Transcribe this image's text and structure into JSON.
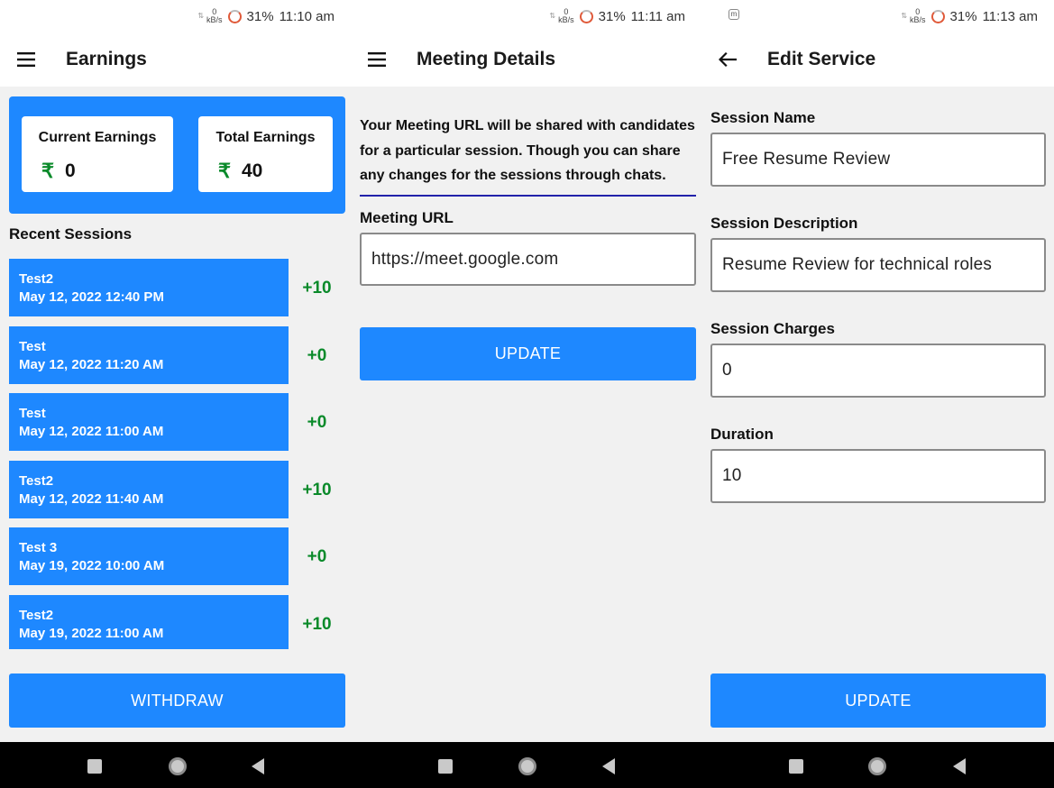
{
  "status_bars": [
    {
      "rate_value": "0",
      "rate_unit": "kB/s",
      "battery": "31%",
      "time": "11:10 am"
    },
    {
      "rate_value": "0",
      "rate_unit": "kB/s",
      "battery": "31%",
      "time": "11:11 am"
    },
    {
      "rate_value": "0",
      "rate_unit": "kB/s",
      "battery": "31%",
      "time": "11:13 am",
      "left_icon": "m"
    }
  ],
  "earnings_screen": {
    "title": "Earnings",
    "current_label": "Current Earnings",
    "current_value": "0",
    "total_label": "Total Earnings",
    "total_value": "40",
    "currency_symbol": "₹",
    "recent_title": "Recent Sessions",
    "sessions": [
      {
        "name": "Test2",
        "datetime": "May 12, 2022 12:40 PM",
        "amount": "+10"
      },
      {
        "name": "Test",
        "datetime": "May 12, 2022 11:20 AM",
        "amount": "+0"
      },
      {
        "name": "Test",
        "datetime": "May 12, 2022 11:00 AM",
        "amount": "+0"
      },
      {
        "name": "Test2",
        "datetime": "May 12, 2022 11:40 AM",
        "amount": "+10"
      },
      {
        "name": "Test 3",
        "datetime": "May 19, 2022 10:00 AM",
        "amount": "+0"
      },
      {
        "name": "Test2",
        "datetime": "May 19, 2022 11:00 AM",
        "amount": "+10"
      }
    ],
    "withdraw_label": "WITHDRAW"
  },
  "meeting_screen": {
    "title": "Meeting Details",
    "info_text": "Your Meeting URL will be shared with candidates for a particular session. Though you can share any changes for the sessions through chats.",
    "url_label": "Meeting URL",
    "url_value": "https://meet.google.com",
    "update_label": "UPDATE"
  },
  "edit_screen": {
    "title": "Edit Service",
    "name_label": "Session Name",
    "name_value": "Free Resume Review",
    "desc_label": "Session Description",
    "desc_value": "Resume Review for technical roles",
    "charges_label": "Session Charges",
    "charges_value": "0",
    "duration_label": "Duration",
    "duration_value": "10",
    "update_label": "UPDATE"
  },
  "colors": {
    "accent": "#1e88ff",
    "positive": "#0a8a2a",
    "background": "#f1f1f1"
  },
  "icons": {
    "menu": "hamburger-menu-icon",
    "back": "back-arrow-icon",
    "currency": "rupee-icon"
  }
}
